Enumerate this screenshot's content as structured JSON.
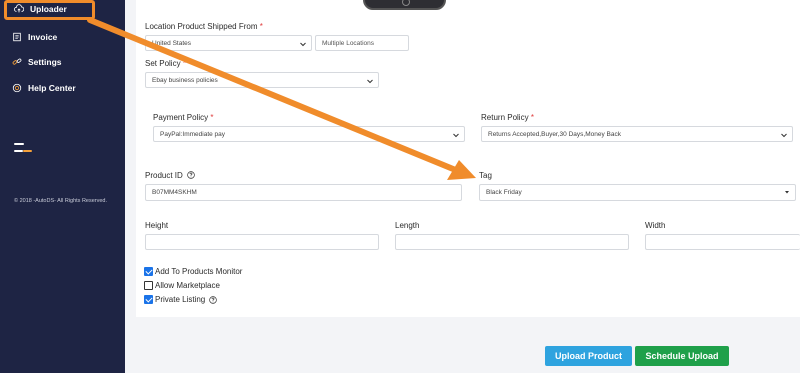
{
  "sidebar": {
    "items": [
      {
        "label": "Uploader",
        "icon": "upload-cloud-icon"
      },
      {
        "label": "Invoice",
        "icon": "invoice-icon"
      },
      {
        "label": "Settings",
        "icon": "link-icon"
      },
      {
        "label": "Help Center",
        "icon": "help-lifebuoy-icon"
      }
    ],
    "copyright": "© 2018 -AutoDS- All Rights Reserved."
  },
  "form": {
    "location": {
      "label": "Location Product Shipped From",
      "required_mark": "*",
      "country": "United States",
      "multiple_placeholder": "Multiple Locations"
    },
    "set_policy": {
      "label": "Set Policy",
      "required_mark": "*",
      "value": "Ebay business policies"
    },
    "payment_policy": {
      "label": "Payment Policy",
      "required_mark": "*",
      "value": "PayPal:Immediate pay"
    },
    "return_policy": {
      "label": "Return Policy",
      "required_mark": "*",
      "value": "Returns Accepted,Buyer,30 Days,Money Back"
    },
    "product_id": {
      "label": "Product ID",
      "value": "B07MM4SKHM"
    },
    "tag": {
      "label": "Tag",
      "value": "Black Friday"
    },
    "height": {
      "label": "Height",
      "value": ""
    },
    "length": {
      "label": "Length",
      "value": ""
    },
    "width": {
      "label": "Width",
      "value": ""
    },
    "checkboxes": [
      {
        "label": "Add To Products Monitor",
        "checked": true
      },
      {
        "label": "Allow Marketplace",
        "checked": false
      },
      {
        "label": "Private Listing",
        "checked": true
      }
    ]
  },
  "actions": {
    "upload_label": "Upload Product",
    "schedule_label": "Schedule Upload"
  },
  "colors": {
    "sidebar_bg": "#1e2444",
    "highlight": "#f08c2b",
    "upload_button": "#2ea3df",
    "schedule_button": "#1fa04a",
    "required": "#e03b3b"
  }
}
